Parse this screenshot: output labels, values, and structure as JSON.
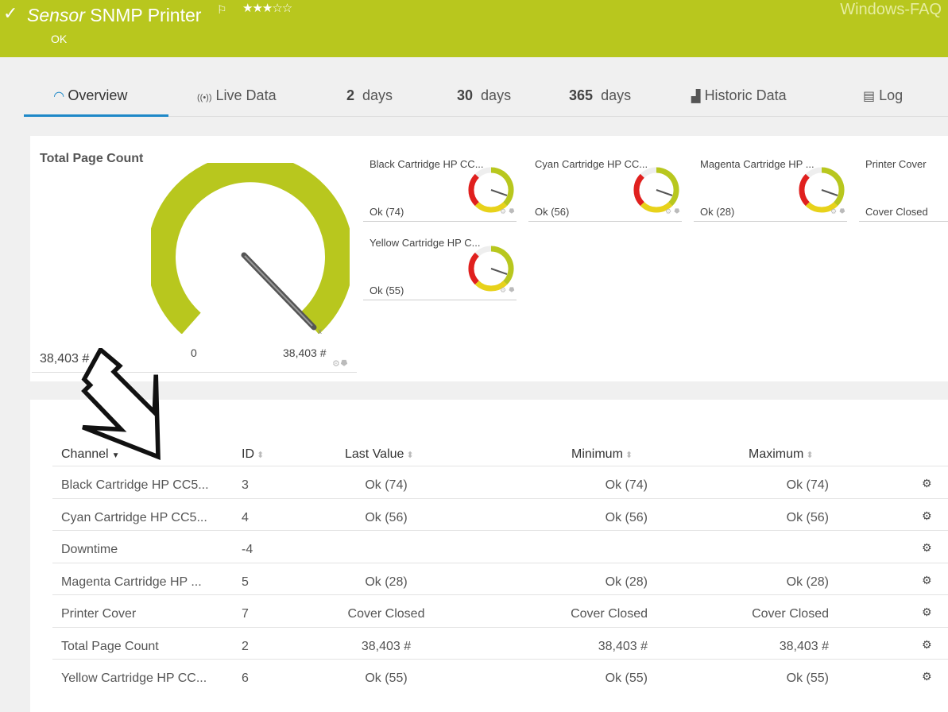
{
  "header": {
    "status_check": "✓",
    "title_prefix": "Sensor",
    "title": "SNMP Printer",
    "flag": "⚐",
    "stars": "★★★☆☆",
    "status": "OK",
    "watermark": "Windows-FAQ"
  },
  "tabs": [
    {
      "icon": "◠",
      "label": "Overview"
    },
    {
      "icon": "((•))",
      "label": "Live Data"
    },
    {
      "num": "2",
      "label": "days"
    },
    {
      "num": "30",
      "label": "days"
    },
    {
      "num": "365",
      "label": "days"
    },
    {
      "icon": "▟",
      "label": "Historic Data"
    },
    {
      "icon": "▤",
      "label": "Log"
    }
  ],
  "main_gauge": {
    "label": "Total Page Count",
    "value": "38,403 #",
    "min_label": "0",
    "max_label": "38,403 #",
    "fill_fraction": 1.0
  },
  "mini_gauges": [
    {
      "title": "Black Cartridge HP CC...",
      "value": "Ok (74)"
    },
    {
      "title": "Cyan Cartridge HP CC...",
      "value": "Ok (56)"
    },
    {
      "title": "Magenta Cartridge HP ...",
      "value": "Ok (28)"
    },
    {
      "title": "Printer Cover",
      "value": "Cover Closed"
    },
    {
      "title": "Yellow Cartridge HP C...",
      "value": "Ok (55)"
    }
  ],
  "table": {
    "headers": {
      "channel": "Channel",
      "id": "ID",
      "last": "Last Value",
      "min": "Minimum",
      "max": "Maximum"
    },
    "rows": [
      {
        "channel": "Black Cartridge HP CC5...",
        "id": "3",
        "last": "Ok (74)",
        "min": "Ok (74)",
        "max": "Ok (74)"
      },
      {
        "channel": "Cyan Cartridge HP CC5...",
        "id": "4",
        "last": "Ok (56)",
        "min": "Ok (56)",
        "max": "Ok (56)"
      },
      {
        "channel": "Downtime",
        "id": "-4",
        "last": "",
        "min": "",
        "max": ""
      },
      {
        "channel": "Magenta Cartridge HP ...",
        "id": "5",
        "last": "Ok (28)",
        "min": "Ok (28)",
        "max": "Ok (28)"
      },
      {
        "channel": "Printer Cover",
        "id": "7",
        "last": "Cover Closed",
        "min": "Cover Closed",
        "max": "Cover Closed"
      },
      {
        "channel": "Total Page Count",
        "id": "2",
        "last": "38,403 #",
        "min": "38,403 #",
        "max": "38,403 #"
      },
      {
        "channel": "Yellow Cartridge HP CC...",
        "id": "6",
        "last": "Ok (55)",
        "min": "Ok (55)",
        "max": "Ok (55)"
      }
    ]
  },
  "colors": {
    "header": "#b8c71e",
    "gauge_green": "#b8c71e",
    "gauge_red": "#e0201e",
    "gauge_yellow": "#e8d21a",
    "tab_active": "#1e88c8"
  },
  "icons": {
    "settings": "gear-icon",
    "pin": "pin-icon",
    "channel_action": "cogs-icon",
    "sort": "sort-icon",
    "arrow": "arrow-annotation"
  }
}
